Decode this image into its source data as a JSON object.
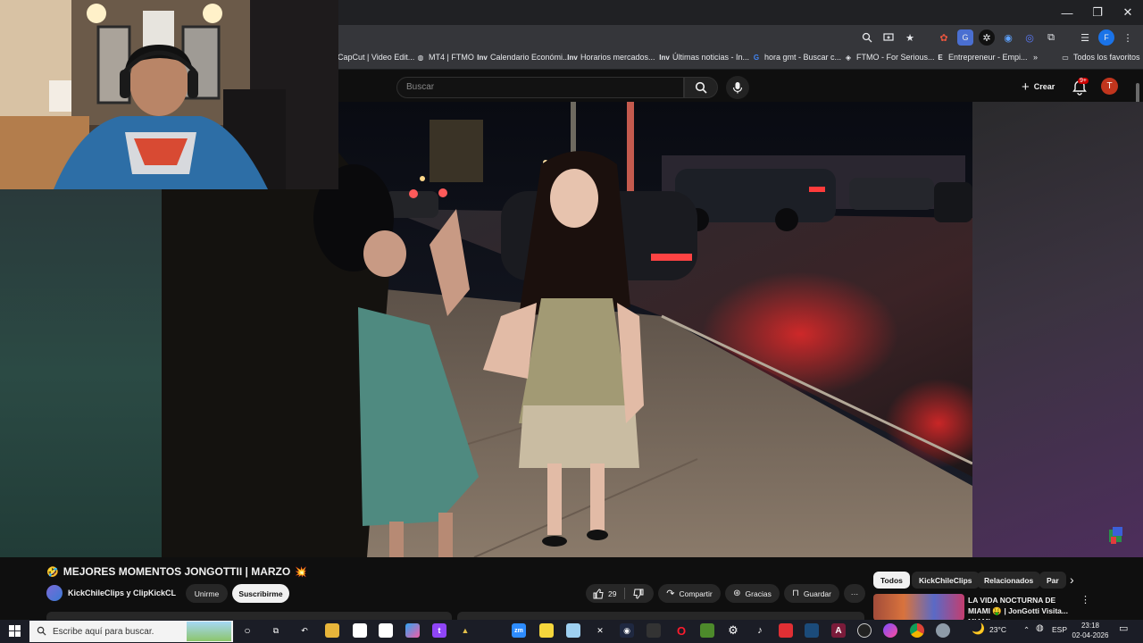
{
  "browser": {
    "window_controls": [
      "—",
      "❐",
      "✕"
    ],
    "bookmarks": [
      {
        "label": "CapCut | Video Edit...",
        "icon": "capcut-icon"
      },
      {
        "label": "MT4 | FTMO",
        "icon": "globe-icon"
      },
      {
        "label": "Calendario Económi...",
        "icon": "inv-icon",
        "icon_text": "Inv"
      },
      {
        "label": "Horarios mercados...",
        "icon": "inv-icon",
        "icon_text": "Inv"
      },
      {
        "label": "Últimas noticias - In...",
        "icon": "inv-icon",
        "icon_text": "Inv"
      },
      {
        "label": "hora gmt - Buscar c...",
        "icon": "google-icon"
      },
      {
        "label": "FTMO - For Serious...",
        "icon": "ftmo-icon"
      },
      {
        "label": "Entrepreneur - Empi...",
        "icon": "entrepreneur-icon",
        "icon_text": "E"
      }
    ],
    "more_bookmarks": "»",
    "all_favorites": "Todos los favoritos"
  },
  "youtube": {
    "search_placeholder": "Buscar",
    "create_label": "Crear",
    "notification_count": "9+",
    "avatar_letter": "T",
    "video": {
      "title": "MEJORES MOMENTOS JONGOTTII | MARZO",
      "title_emoji_left": "🤣",
      "title_emoji_right": "💥",
      "channel": "KickChileClips y ClipKickCL",
      "join_label": "Unirme",
      "subscribe_label": "Suscribirme",
      "likes": "29",
      "share_label": "Compartir",
      "thanks_label": "Gracias",
      "save_label": "Guardar",
      "more_label": "···"
    },
    "chips": [
      "Todos",
      "KickChileClips",
      "Relacionados",
      "Par"
    ],
    "chip_next": "›",
    "recommendation": {
      "title": "LA VIDA NOCTURNA DE MIAMI 🤑 | JonGotti Visita... MIAMI ..."
    }
  },
  "taskbar": {
    "search_placeholder": "Escribe aquí para buscar.",
    "weather": "23°C",
    "language": "ESP",
    "time": "23:18",
    "date": "02-04-2026",
    "icons": [
      "o",
      "tv",
      "c",
      "folder",
      "doc",
      "copilot",
      "twitch",
      "vortex",
      "zoom",
      "sticky",
      "notes",
      "capcut",
      "vpn",
      "opera",
      "minecraft",
      "settings",
      "tiktok",
      "anydesk",
      "steam",
      "affinity",
      "obs",
      "messenger",
      "chrome",
      "unknown"
    ]
  },
  "colors": {
    "youtube_red": "#cc0000",
    "avatar": "#c1351d",
    "chrome_dark": "#202124"
  }
}
